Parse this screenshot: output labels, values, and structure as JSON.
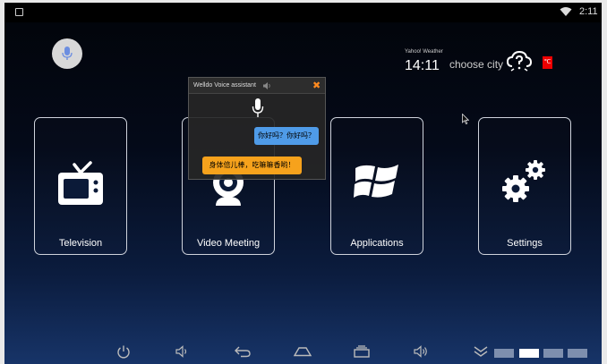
{
  "status_bar": {
    "time": "2:11"
  },
  "weather": {
    "source": "Yahoo! Weather",
    "time": "14:11",
    "city": "choose city",
    "unit": "℃"
  },
  "tiles": [
    {
      "label": "Television",
      "icon": "tv-icon"
    },
    {
      "label": "Video Meeting",
      "icon": "webcam-icon"
    },
    {
      "label": "Applications",
      "icon": "windows-icon"
    },
    {
      "label": "Settings",
      "icon": "gears-icon"
    }
  ],
  "voice_dialog": {
    "title": "Welldo Voice assistant",
    "close": "✖",
    "user_message": "你好吗？你好吗？",
    "assistant_reply": "身体倍儿棒，吃嘛嘛香哟！"
  },
  "navbar": {
    "buttons": [
      "power-icon",
      "volume-down-icon",
      "back-icon",
      "home-icon",
      "recent-apps-icon",
      "volume-up-icon",
      "collapse-icon"
    ]
  },
  "colors": {
    "background_top": "#020409",
    "background_bottom": "#173468",
    "user_bubble": "#4f9be8",
    "assistant_bubble": "#f6a21c",
    "close_accent": "#ff8a1f",
    "unit_badge": "#e00000"
  }
}
